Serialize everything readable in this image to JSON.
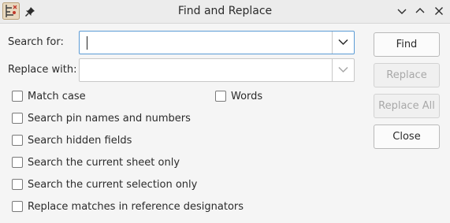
{
  "window": {
    "title": "Find and Replace",
    "icons": [
      "app-icon",
      "pin-icon",
      "minimize-icon",
      "maximize-icon",
      "close-icon"
    ]
  },
  "search": {
    "label": "Search for:",
    "value": "",
    "placeholder": ""
  },
  "replace": {
    "label": "Replace with:",
    "value": "",
    "placeholder": ""
  },
  "options": {
    "match_case": "Match case",
    "words": "Words",
    "pin_names": "Search pin names and numbers",
    "hidden_fields": "Search hidden fields",
    "current_sheet": "Search the current sheet only",
    "current_selection": "Search the current selection only",
    "reference_designators": "Replace matches in reference designators"
  },
  "buttons": {
    "find": "Find",
    "replace": "Replace",
    "replace_all": "Replace All",
    "close": "Close"
  },
  "colors": {
    "accent": "#5b9bd5",
    "disabled_text": "#a8a8a8"
  }
}
